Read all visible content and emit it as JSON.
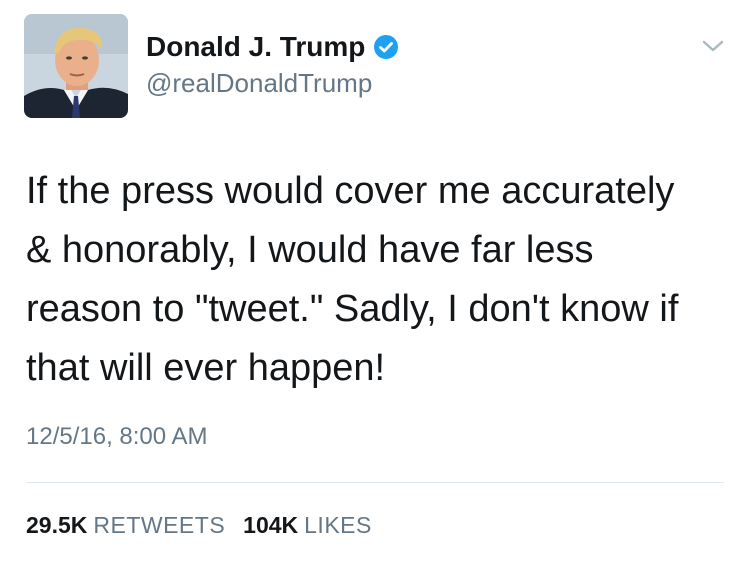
{
  "author": {
    "display_name": "Donald J. Trump",
    "handle": "@realDonaldTrump",
    "verified": true,
    "avatar_icon": "profile-photo"
  },
  "tweet": {
    "text": "If the press would cover me accurately\n& honorably, I would have far less\nreason to \"tweet.\" Sadly, I don't know if\nthat will ever happen!",
    "timestamp": "12/5/16, 8:00 AM"
  },
  "stats": {
    "retweets_count": "29.5K",
    "retweets_label": "RETWEETS",
    "likes_count": "104K",
    "likes_label": "LIKES"
  },
  "colors": {
    "verified_blue": "#1da1f2",
    "secondary_text": "#657786",
    "primary_text": "#14171a",
    "divider": "#e1e8ed"
  },
  "icons": {
    "verified": "verified-badge-icon",
    "menu": "chevron-down-icon"
  }
}
